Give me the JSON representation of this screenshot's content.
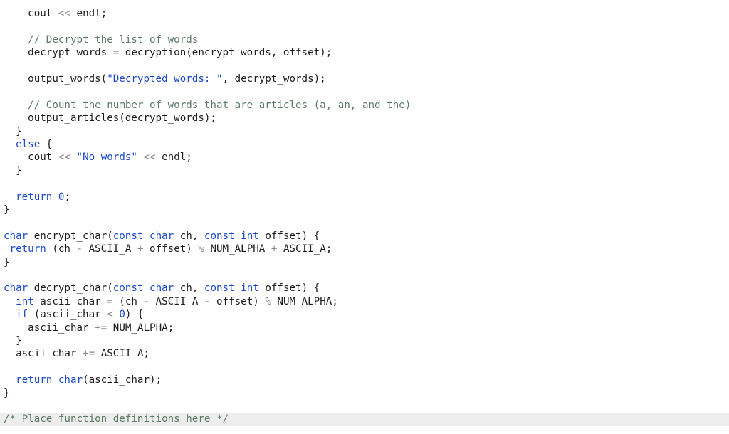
{
  "editor": {
    "lines": [
      [
        {
          "t": "    "
        },
        {
          "t": "cout "
        },
        {
          "t": "<<",
          "c": "op"
        },
        {
          "t": " endl;"
        }
      ],
      [],
      [
        {
          "t": "    "
        },
        {
          "t": "// Decrypt the list of words",
          "c": "cm"
        }
      ],
      [
        {
          "t": "    "
        },
        {
          "t": "decrypt_words "
        },
        {
          "t": "=",
          "c": "op"
        },
        {
          "t": " decryption(encrypt_words, offset);"
        }
      ],
      [],
      [
        {
          "t": "    "
        },
        {
          "t": "output_words("
        },
        {
          "t": "\"Decrypted words: \"",
          "c": "str"
        },
        {
          "t": ", decrypt_words);"
        }
      ],
      [],
      [
        {
          "t": "    "
        },
        {
          "t": "// Count the number of words that are articles (a, an, and the)",
          "c": "cm"
        }
      ],
      [
        {
          "t": "    "
        },
        {
          "t": "output_articles(decrypt_words);"
        }
      ],
      [
        {
          "t": "  "
        },
        {
          "t": "}"
        }
      ],
      [
        {
          "t": "  "
        },
        {
          "t": "else",
          "c": "kw"
        },
        {
          "t": " {"
        }
      ],
      [
        {
          "t": "    "
        },
        {
          "t": "cout "
        },
        {
          "t": "<<",
          "c": "op"
        },
        {
          "t": " "
        },
        {
          "t": "\"No words\"",
          "c": "str"
        },
        {
          "t": " "
        },
        {
          "t": "<<",
          "c": "op"
        },
        {
          "t": " endl;"
        }
      ],
      [
        {
          "t": "  "
        },
        {
          "t": "}"
        }
      ],
      [],
      [
        {
          "t": "  "
        },
        {
          "t": "return",
          "c": "kw"
        },
        {
          "t": " "
        },
        {
          "t": "0",
          "c": "num"
        },
        {
          "t": ";"
        }
      ],
      [
        {
          "t": "}"
        }
      ],
      [],
      [
        {
          "t": "char",
          "c": "kw"
        },
        {
          "t": " encrypt_char("
        },
        {
          "t": "const",
          "c": "kw"
        },
        {
          "t": " "
        },
        {
          "t": "char",
          "c": "kw"
        },
        {
          "t": " ch, "
        },
        {
          "t": "const",
          "c": "kw"
        },
        {
          "t": " "
        },
        {
          "t": "int",
          "c": "kw"
        },
        {
          "t": " offset) {"
        }
      ],
      [
        {
          "t": " "
        },
        {
          "t": "return",
          "c": "kw"
        },
        {
          "t": " (ch "
        },
        {
          "t": "-",
          "c": "op"
        },
        {
          "t": " ASCII_A "
        },
        {
          "t": "+",
          "c": "op"
        },
        {
          "t": " offset) "
        },
        {
          "t": "%",
          "c": "op"
        },
        {
          "t": " NUM_ALPHA "
        },
        {
          "t": "+",
          "c": "op"
        },
        {
          "t": " ASCII_A;"
        }
      ],
      [
        {
          "t": "}"
        }
      ],
      [],
      [
        {
          "t": "char",
          "c": "kw"
        },
        {
          "t": " decrypt_char("
        },
        {
          "t": "const",
          "c": "kw"
        },
        {
          "t": " "
        },
        {
          "t": "char",
          "c": "kw"
        },
        {
          "t": " ch, "
        },
        {
          "t": "const",
          "c": "kw"
        },
        {
          "t": " "
        },
        {
          "t": "int",
          "c": "kw"
        },
        {
          "t": " offset) {"
        }
      ],
      [
        {
          "t": "  "
        },
        {
          "t": "int",
          "c": "kw"
        },
        {
          "t": " ascii_char "
        },
        {
          "t": "=",
          "c": "op"
        },
        {
          "t": " (ch "
        },
        {
          "t": "-",
          "c": "op"
        },
        {
          "t": " ASCII_A "
        },
        {
          "t": "-",
          "c": "op"
        },
        {
          "t": " offset) "
        },
        {
          "t": "%",
          "c": "op"
        },
        {
          "t": " NUM_ALPHA;"
        }
      ],
      [
        {
          "t": "  "
        },
        {
          "t": "if",
          "c": "kw"
        },
        {
          "t": " (ascii_char "
        },
        {
          "t": "<",
          "c": "op"
        },
        {
          "t": " "
        },
        {
          "t": "0",
          "c": "num"
        },
        {
          "t": ") {"
        }
      ],
      [
        {
          "t": "    "
        },
        {
          "t": "ascii_char "
        },
        {
          "t": "+=",
          "c": "op"
        },
        {
          "t": " NUM_ALPHA;"
        }
      ],
      [
        {
          "t": "  "
        },
        {
          "t": "}"
        }
      ],
      [
        {
          "t": "  "
        },
        {
          "t": "ascii_char "
        },
        {
          "t": "+=",
          "c": "op"
        },
        {
          "t": " ASCII_A;"
        }
      ],
      [],
      [
        {
          "t": "  "
        },
        {
          "t": "return",
          "c": "kw"
        },
        {
          "t": " "
        },
        {
          "t": "char",
          "c": "kw"
        },
        {
          "t": "(ascii_char);"
        }
      ],
      [
        {
          "t": "}"
        }
      ],
      [],
      [
        {
          "t": "/* Place function definitions here */",
          "c": "cm"
        }
      ]
    ]
  }
}
